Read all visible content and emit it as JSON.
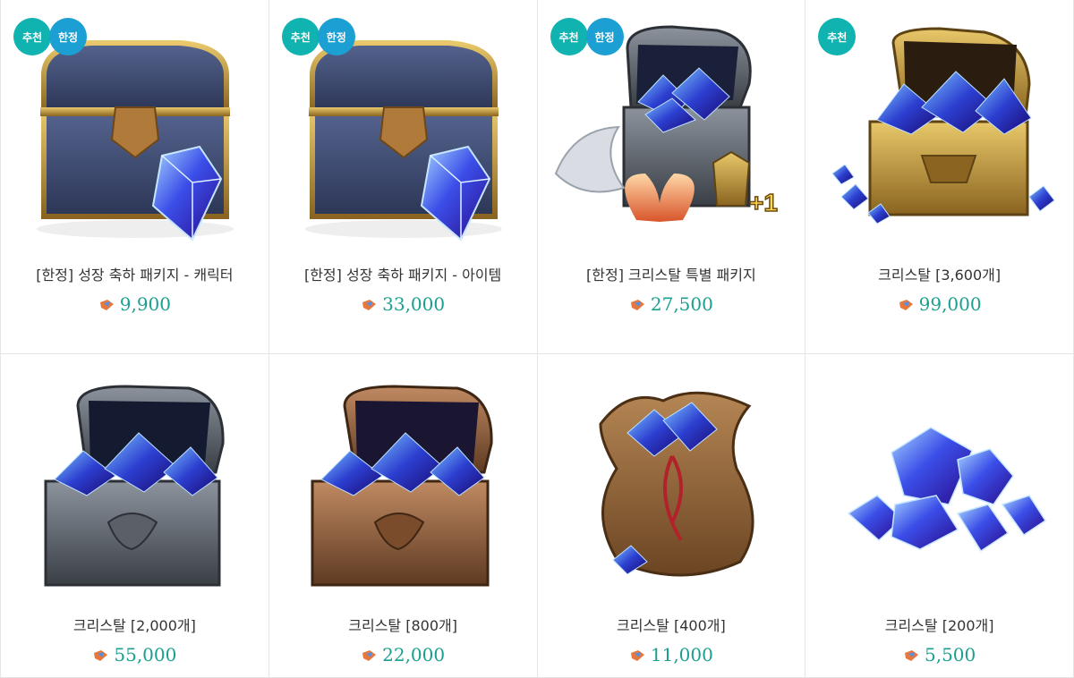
{
  "badges": {
    "recommend": "추천",
    "limited": "한정"
  },
  "products": [
    {
      "title": "[한정] 성장 축하 패키지 - 캐릭터",
      "price": "9,900",
      "icon": "blue-chest-with-crystal",
      "badges": [
        "recommend",
        "limited"
      ]
    },
    {
      "title": "[한정] 성장 축하 패키지 - 아이템",
      "price": "33,000",
      "icon": "blue-chest-with-crystal",
      "badges": [
        "recommend",
        "limited"
      ]
    },
    {
      "title": "[한정] 크리스탈 특별 패키지",
      "price": "27,500",
      "icon": "silver-chest-with-wings",
      "badges": [
        "recommend",
        "limited"
      ]
    },
    {
      "title": "크리스탈 [3,600개]",
      "price": "99,000",
      "icon": "gold-chest-crystals",
      "badges": [
        "recommend"
      ]
    },
    {
      "title": "크리스탈 [2,000개]",
      "price": "55,000",
      "icon": "silver-chest-crystals",
      "badges": []
    },
    {
      "title": "크리스탈 [800개]",
      "price": "22,000",
      "icon": "bronze-chest-crystals",
      "badges": []
    },
    {
      "title": "크리스탈 [400개]",
      "price": "11,000",
      "icon": "crystal-bag",
      "badges": []
    },
    {
      "title": "크리스탈 [200개]",
      "price": "5,500",
      "icon": "crystal-pile",
      "badges": []
    }
  ],
  "colors": {
    "price": "#1aa08f",
    "badge_recommend": "#10b3b0",
    "badge_limited": "#1c9fd3"
  }
}
